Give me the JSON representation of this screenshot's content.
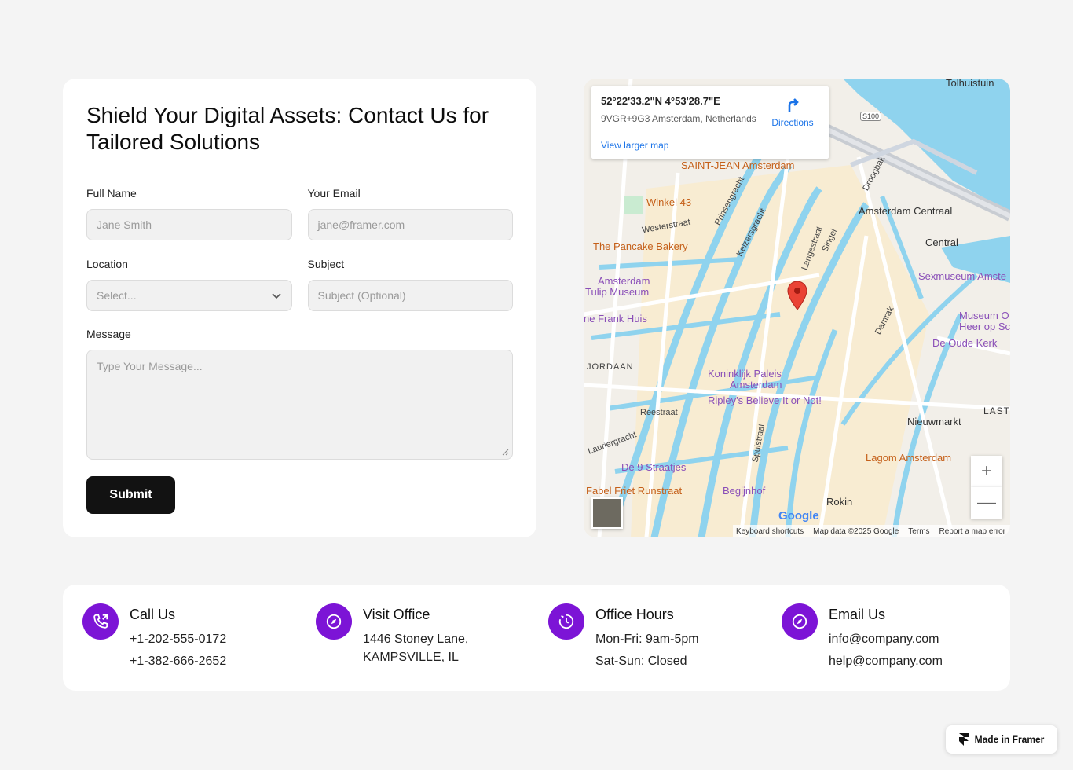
{
  "form": {
    "title": "Shield Your Digital Assets: Contact Us for Tailored Solutions",
    "full_name_label": "Full Name",
    "full_name_placeholder": "Jane Smith",
    "email_label": "Your Email",
    "email_placeholder": "jane@framer.com",
    "location_label": "Location",
    "location_value": "Select...",
    "subject_label": "Subject",
    "subject_placeholder": "Subject (Optional)",
    "message_label": "Message",
    "message_placeholder": "Type Your Message...",
    "submit_label": "Submit"
  },
  "map": {
    "coords": "52°22'33.2\"N 4°53'28.7\"E",
    "plus_code": "9VGR+9G3 Amsterdam, Netherlands",
    "directions_label": "Directions",
    "larger_map_label": "View larger map",
    "labels": {
      "saint_jean": "SAINT-JEAN Amsterdam",
      "winkel": "Winkel 43",
      "pancake": "The Pancake Bakery",
      "tulip1": "Amsterdam",
      "tulip2": "Tulip Museum",
      "frank": "ne Frank Huis",
      "paleis1": "Koninklijk Paleis",
      "paleis2": "Amsterdam",
      "ripley": "Ripley's Believe It or Not!",
      "centraal": "Amsterdam Centraal",
      "central": "Central",
      "sexmuseum": "Sexmuseum Amste",
      "museum1": "Museum O",
      "museum2": "Heer op Sc",
      "oude_kerk": "De Oude Kerk",
      "nieuwmarkt": "Nieuwmarkt",
      "lagom": "Lagom Amsterdam",
      "negen": "De 9 Straatjes",
      "fabel": "Fabel Friet Runstraat",
      "begijnhof": "Begijnhof",
      "rokin": "Rokin",
      "tolhuistuin": "Tolhuistuin",
      "jordaan": "JORDAAN",
      "last": "LAST",
      "reestraat": "Reestraat",
      "westerstraat": "Westerstraat",
      "prinsengracht": "Prinsengracht",
      "keizersgracht": "Keizersgracht",
      "langestraat": "Langestraat",
      "singel": "Singel",
      "droogbak": "Droogbak",
      "damrak": "Damrak",
      "spuistraat": "Spuistraat",
      "lauriergracht": "Lauriergracht",
      "s100": "S100"
    },
    "zoom_in": "+",
    "zoom_out": "—",
    "google": "Google",
    "footer": {
      "shortcuts": "Keyboard shortcuts",
      "map_data": "Map data ©2025 Google",
      "terms": "Terms",
      "report": "Report a map error"
    }
  },
  "contact": {
    "call": {
      "title": "Call Us",
      "line1": "+1-202-555-0172",
      "line2": "+1-382-666-2652"
    },
    "office": {
      "title": "Visit Office",
      "line1": "1446 Stoney Lane,",
      "line2": "KAMPSVILLE, IL"
    },
    "hours": {
      "title": "Office Hours",
      "line1": "Mon-Fri: 9am-5pm",
      "line2": "Sat-Sun: Closed"
    },
    "email": {
      "title": "Email Us",
      "line1": "info@company.com",
      "line2": "help@company.com"
    }
  },
  "badge": {
    "label": "Made in Framer"
  },
  "colors": {
    "accent": "#7c14d6",
    "button": "#121212",
    "water": "#8fd3ee",
    "link": "#1a73e8"
  }
}
